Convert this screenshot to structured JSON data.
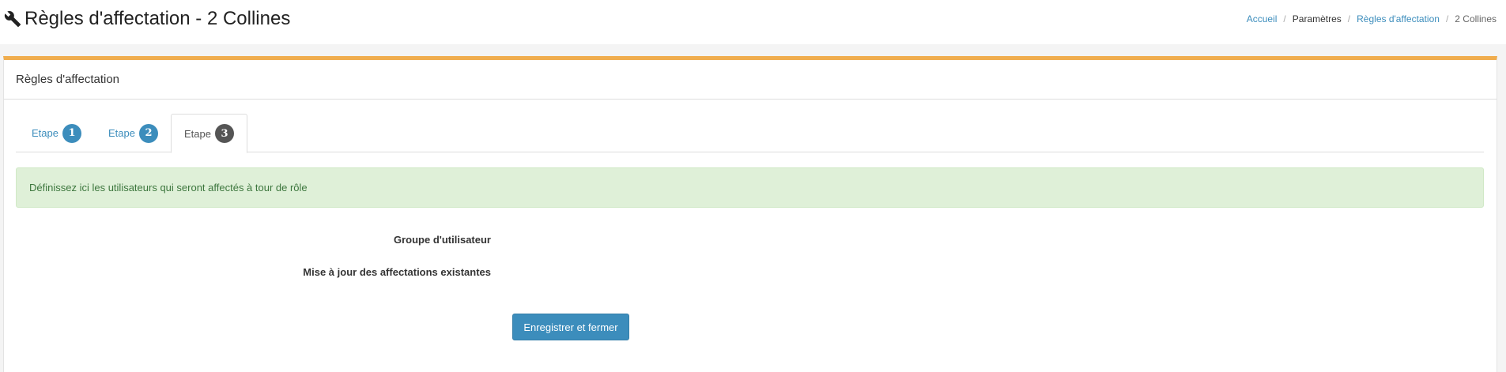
{
  "header": {
    "title": "Règles d'affectation - 2 Collines",
    "icon": "wrench-icon"
  },
  "breadcrumb": {
    "items": [
      {
        "label": "Accueil",
        "type": "link"
      },
      {
        "label": "Paramètres",
        "type": "plain"
      },
      {
        "label": "Règles d'affectation",
        "type": "link"
      },
      {
        "label": "2 Collines",
        "type": "active"
      }
    ],
    "separator": "/"
  },
  "box": {
    "title": "Règles d'affectation",
    "accent_color": "#f0ad4e"
  },
  "tabs": [
    {
      "label": "Etape",
      "badge": "1",
      "active": false
    },
    {
      "label": "Etape",
      "badge": "2",
      "active": false
    },
    {
      "label": "Etape",
      "badge": "3",
      "active": true
    }
  ],
  "alert": {
    "text": "Définissez ici les utilisateurs qui seront affectés à tour de rôle"
  },
  "form": {
    "group_label": "Groupe d'utilisateur",
    "update_label": "Mise à jour des affectations existantes",
    "submit_label": "Enregistrer et fermer"
  },
  "colors": {
    "primary": "#3c8dbc",
    "success_bg": "#dff0d8",
    "active_badge": "#555555"
  }
}
